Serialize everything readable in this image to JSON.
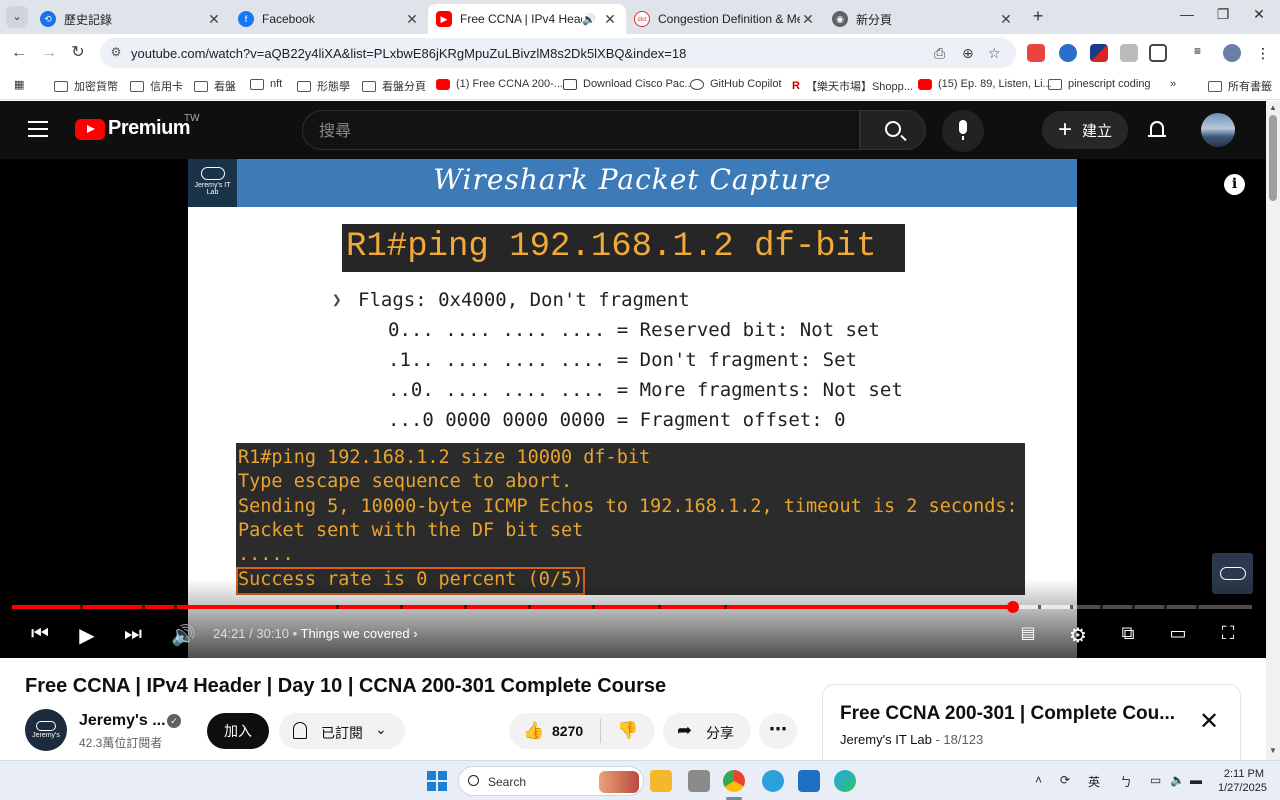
{
  "browser": {
    "tabs": [
      {
        "title": "歷史記錄",
        "favicon": "history-icon",
        "active": false
      },
      {
        "title": "Facebook",
        "favicon": "facebook-icon",
        "active": false
      },
      {
        "title": "Free CCNA | IPv4 Header | D",
        "favicon": "youtube-icon",
        "active": true
      },
      {
        "title": "Congestion Definition & Meani",
        "favicon": "dictionary-icon",
        "active": false
      },
      {
        "title": "新分頁",
        "favicon": "chrome-icon",
        "active": false
      }
    ],
    "url": "youtube.com/watch?v=aQB22y4liXA&list=PLxbwE86jKRgMpuZuLBivzlM8s2Dk5lXBQ&index=18",
    "bookmarks": [
      "加密貨幣",
      "信用卡",
      "看盤",
      "nft",
      "形態學",
      "看盤分頁",
      "(1) Free CCNA 200-...",
      "Download Cisco Pac...",
      "GitHub Copilot",
      "【樂天市場】Shopp...",
      "(15) Ep. 89, Listen, Li...",
      "pinescript coding",
      "所有書籤"
    ],
    "overflow": "»"
  },
  "youtube": {
    "brand": "Premium",
    "country": "TW",
    "search_placeholder": "搜尋",
    "create_label": "建立"
  },
  "video": {
    "slide_title": "Wireshark Packet Capture",
    "slide_logo": "Jeremy's IT Lab",
    "slide_cmd": "R1#ping 192.168.1.2 df-bit",
    "flags": [
      "Flags: 0x4000, Don't fragment",
      "0... .... .... .... = Reserved bit: Not set",
      ".1.. .... .... .... = Don't fragment: Set",
      "..0. .... .... .... = More fragments: Not set",
      "...0 0000 0000 0000 = Fragment offset: 0"
    ],
    "terminal": [
      "R1#ping 192.168.1.2 size 10000 df-bit",
      "Type escape sequence to abort.",
      "Sending 5, 10000-byte ICMP Echos to 192.168.1.2, timeout is 2 seconds:",
      "Packet sent with the DF bit set",
      ".....",
      "Success rate is 0 percent (0/5)"
    ],
    "current_time": "24:21",
    "duration": "30:10",
    "time_sep": " / ",
    "chapter": "Things we covered",
    "progress_fraction": 0.807,
    "buffer_fraction": 0.855,
    "title": "Free CCNA | IPv4 Header | Day 10 | CCNA 200-301 Complete Course"
  },
  "channel": {
    "name": "Jeremy's ...",
    "subscribers": "42.3萬位訂閱者",
    "join_label": "加入",
    "subscribed_label": "已訂閱"
  },
  "actions": {
    "like_count": "8270",
    "share_label": "分享"
  },
  "playlist": {
    "title": "Free CCNA 200-301 | Complete Cou...",
    "owner": "Jeremy's IT Lab",
    "position": "18/123"
  },
  "taskbar": {
    "search_label": "Search",
    "ime": "英",
    "time": "2:11 PM",
    "date": "1/27/2025"
  },
  "colors": {
    "yt_red": "#ff0000",
    "slide_blue": "#3d7bb8",
    "terminal_text": "#e8a42e",
    "highlight_border": "#d8611d"
  }
}
